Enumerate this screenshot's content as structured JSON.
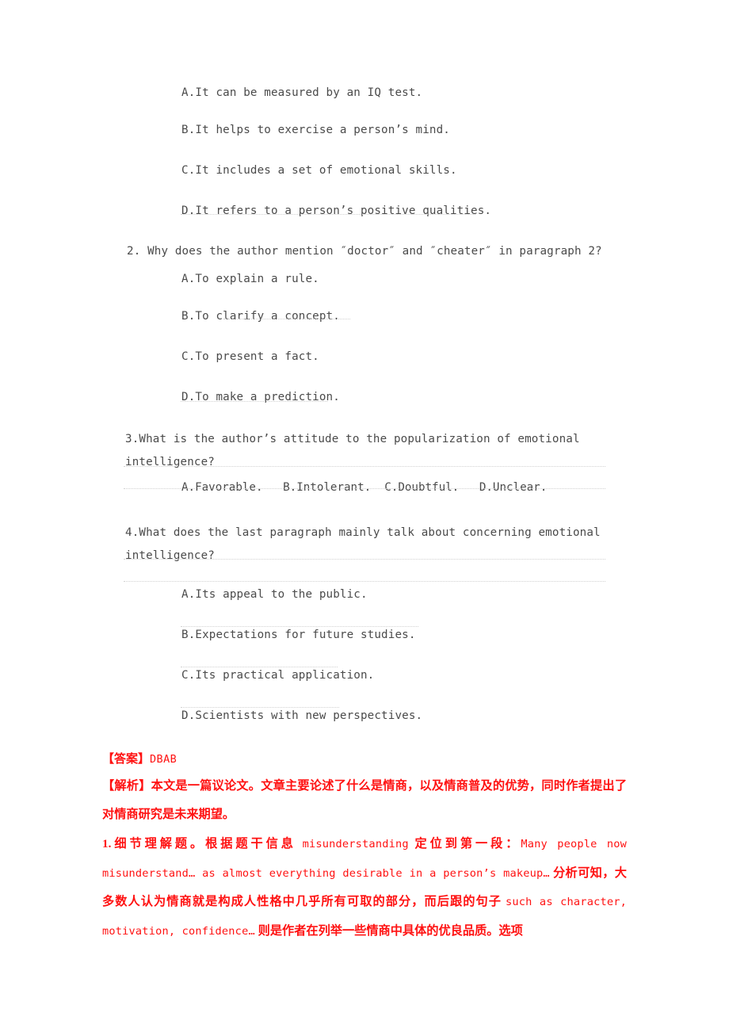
{
  "document": {
    "type": "english-exam-answer-key-page",
    "answer_color": "#ff1111",
    "body_color": "#4a4a4a"
  },
  "questions": [
    {
      "number": "",
      "stem": "",
      "options": [
        "A.It can be measured by an IQ test.",
        "B.It helps to exercise a person’s mind.",
        "C.It includes a set of emotional skills.",
        "D.It refers to a person’s positive qualities."
      ]
    },
    {
      "number": "2.",
      "stem": "2. Why does the author mention ″doctor″ and ″cheater″ in paragraph 2?",
      "options": [
        "A.To explain a rule.",
        "B.To clarify a concept.",
        "C.To present a fact.",
        "D.To make a prediction."
      ]
    },
    {
      "number": "3.",
      "stem_line1": "3.What is the author’s attitude to the popularization of emotional",
      "stem_line2": "intelligence?",
      "options_inline": "A.Favorable.   B.Intolerant.  C.Doubtful.   D.Unclear."
    },
    {
      "number": "4.",
      "stem_line1": "4.What does the last paragraph mainly talk about concerning emotional",
      "stem_line2": "intelligence?",
      "options": [
        "A.Its appeal to the public.",
        "B.Expectations for future studies.",
        "C.Its practical application.",
        "D.Scientists with new perspectives."
      ]
    }
  ],
  "answer_block": {
    "answer_label": "【答案】",
    "answer_value": "DBAB",
    "analysis_label": "【解析】",
    "analysis_text": "本文是一篇议论文。文章主要论述了什么是情商，以及情商普及的优势，同时作者提出了对情商研究是未来期望。",
    "explanation_1": {
      "seg1": "1.细节理解题。根据题干信息 ",
      "seg2_mono": "misunderstanding",
      "seg3": " 定位到第一段：",
      "seg4_mono": "Many people now misunderstand…  as almost everything desirable in a person’s makeup…",
      "seg5": "  分析可知，大多数人认为情商就是构成人性格中几乎所有可取的部分，而后跟的句子 ",
      "seg6_mono": "such as character, motivation, confidence…",
      "seg7": "  则是作者在列举一些情商中具体的优良品质。选项"
    }
  }
}
